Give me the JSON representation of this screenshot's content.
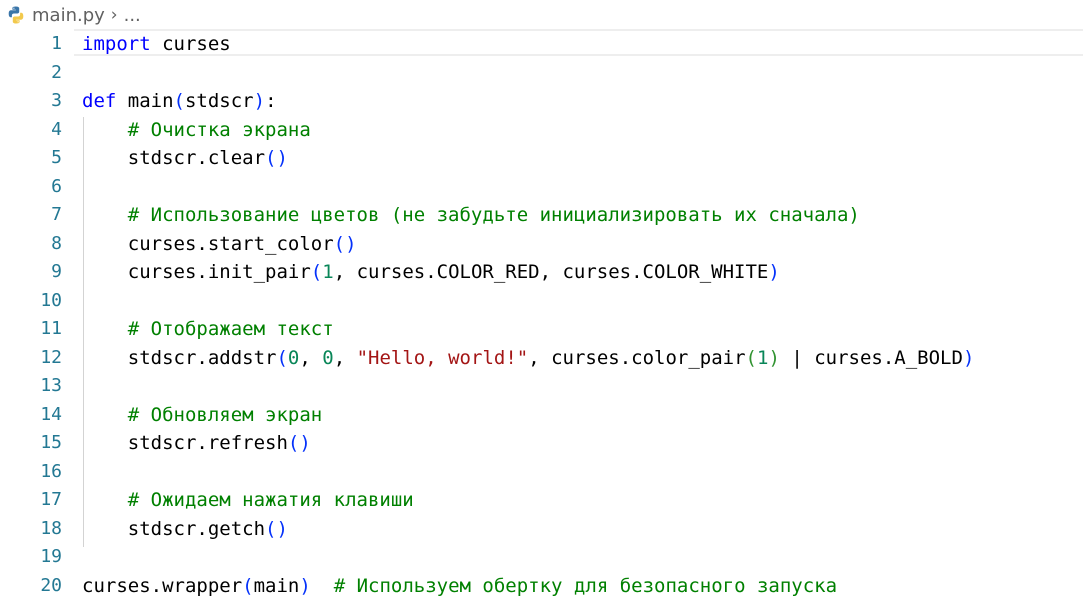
{
  "breadcrumb": {
    "file": "main.py",
    "separator": "›",
    "more": "..."
  },
  "editor": {
    "lines": [
      {
        "n": "1",
        "tokens": [
          {
            "t": "import",
            "c": "kw"
          },
          {
            "t": " curses",
            "c": "fn"
          }
        ]
      },
      {
        "n": "2",
        "tokens": []
      },
      {
        "n": "3",
        "tokens": [
          {
            "t": "def",
            "c": "kw"
          },
          {
            "t": " main",
            "c": "fn"
          },
          {
            "t": "(",
            "c": "p1"
          },
          {
            "t": "stdscr",
            "c": "fn"
          },
          {
            "t": ")",
            "c": "p1"
          },
          {
            "t": ":",
            "c": "fn"
          }
        ]
      },
      {
        "n": "4",
        "tokens": [
          {
            "t": "    ",
            "c": "fn"
          },
          {
            "t": "# Очистка экрана",
            "c": "cm"
          }
        ]
      },
      {
        "n": "5",
        "tokens": [
          {
            "t": "    stdscr.clear",
            "c": "fn"
          },
          {
            "t": "()",
            "c": "p1"
          }
        ]
      },
      {
        "n": "6",
        "tokens": []
      },
      {
        "n": "7",
        "tokens": [
          {
            "t": "    ",
            "c": "fn"
          },
          {
            "t": "# Использование цветов (не забудьте инициализировать их сначала)",
            "c": "cm"
          }
        ]
      },
      {
        "n": "8",
        "tokens": [
          {
            "t": "    curses.start_color",
            "c": "fn"
          },
          {
            "t": "()",
            "c": "p1"
          }
        ]
      },
      {
        "n": "9",
        "tokens": [
          {
            "t": "    curses.init_pair",
            "c": "fn"
          },
          {
            "t": "(",
            "c": "p1"
          },
          {
            "t": "1",
            "c": "num"
          },
          {
            "t": ", curses.COLOR_RED, curses.COLOR_WHITE",
            "c": "fn"
          },
          {
            "t": ")",
            "c": "p1"
          }
        ]
      },
      {
        "n": "10",
        "tokens": []
      },
      {
        "n": "11",
        "tokens": [
          {
            "t": "    ",
            "c": "fn"
          },
          {
            "t": "# Отображаем текст",
            "c": "cm"
          }
        ]
      },
      {
        "n": "12",
        "tokens": [
          {
            "t": "    stdscr.addstr",
            "c": "fn"
          },
          {
            "t": "(",
            "c": "p1"
          },
          {
            "t": "0",
            "c": "num"
          },
          {
            "t": ", ",
            "c": "fn"
          },
          {
            "t": "0",
            "c": "num"
          },
          {
            "t": ", ",
            "c": "fn"
          },
          {
            "t": "\"Hello, world!\"",
            "c": "str"
          },
          {
            "t": ", curses.color_pair",
            "c": "fn"
          },
          {
            "t": "(",
            "c": "p2"
          },
          {
            "t": "1",
            "c": "num"
          },
          {
            "t": ")",
            "c": "p2"
          },
          {
            "t": " | curses.A_BOLD",
            "c": "fn"
          },
          {
            "t": ")",
            "c": "p1"
          }
        ]
      },
      {
        "n": "13",
        "tokens": []
      },
      {
        "n": "14",
        "tokens": [
          {
            "t": "    ",
            "c": "fn"
          },
          {
            "t": "# Обновляем экран",
            "c": "cm"
          }
        ]
      },
      {
        "n": "15",
        "tokens": [
          {
            "t": "    stdscr.refresh",
            "c": "fn"
          },
          {
            "t": "()",
            "c": "p1"
          }
        ]
      },
      {
        "n": "16",
        "tokens": []
      },
      {
        "n": "17",
        "tokens": [
          {
            "t": "    ",
            "c": "fn"
          },
          {
            "t": "# Ожидаем нажатия клавиши",
            "c": "cm"
          }
        ]
      },
      {
        "n": "18",
        "tokens": [
          {
            "t": "    stdscr.getch",
            "c": "fn"
          },
          {
            "t": "()",
            "c": "p1"
          }
        ]
      },
      {
        "n": "19",
        "tokens": []
      },
      {
        "n": "20",
        "tokens": [
          {
            "t": "curses.wrapper",
            "c": "fn"
          },
          {
            "t": "(",
            "c": "p1"
          },
          {
            "t": "main",
            "c": "fn"
          },
          {
            "t": ")",
            "c": "p1"
          },
          {
            "t": "  ",
            "c": "fn"
          },
          {
            "t": "# Используем обертку для безопасного запуска",
            "c": "cm"
          }
        ]
      }
    ]
  },
  "colors": {
    "keyword": "#0000ff",
    "comment": "#008000",
    "string": "#a31515",
    "number": "#098658",
    "bracket_level1": "#0431fa",
    "bracket_level2": "#319331",
    "line_number": "#237893"
  },
  "icons": {
    "breadcrumb_file_icon": "python-icon"
  }
}
